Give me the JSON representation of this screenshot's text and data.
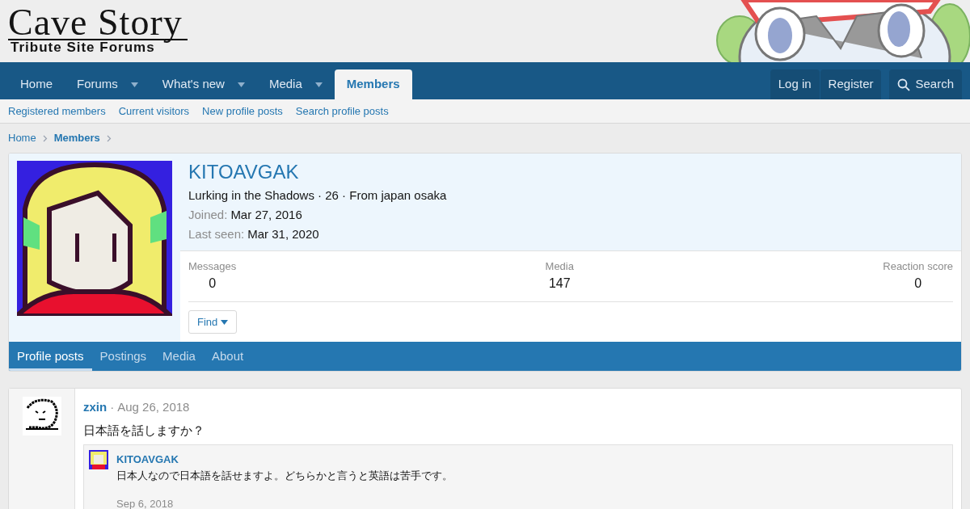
{
  "logo": {
    "title": "Cave Story",
    "subtitle": "Tribute Site Forums"
  },
  "nav": {
    "tabs": [
      {
        "label": "Home",
        "dropdown": false,
        "selected": false
      },
      {
        "label": "Forums",
        "dropdown": true,
        "selected": false
      },
      {
        "label": "What's new",
        "dropdown": true,
        "selected": false
      },
      {
        "label": "Media",
        "dropdown": true,
        "selected": false
      },
      {
        "label": "Members",
        "dropdown": false,
        "selected": true
      }
    ],
    "account": [
      "Log in",
      "Register"
    ],
    "search": "Search"
  },
  "subnav": [
    "Registered members",
    "Current visitors",
    "New profile posts",
    "Search profile posts"
  ],
  "breadcrumb": [
    "Home",
    "Members"
  ],
  "profile": {
    "username": "KITOAVGAK",
    "blurb": "Lurking in the Shadows · 26 · From japan osaka",
    "facts": [
      {
        "label": "Joined:",
        "value": "Mar 27, 2016"
      },
      {
        "label": "Last seen:",
        "value": "Mar 31, 2020"
      }
    ],
    "stats": [
      {
        "label": "Messages",
        "value": "0"
      },
      {
        "label": "Media",
        "value": "147"
      },
      {
        "label": "Reaction score",
        "value": "0"
      }
    ],
    "find": "Find",
    "tabs": [
      {
        "label": "Profile posts",
        "selected": true
      },
      {
        "label": "Postings",
        "selected": false
      },
      {
        "label": "Media",
        "selected": false
      },
      {
        "label": "About",
        "selected": false
      }
    ]
  },
  "post": {
    "author": "zxin",
    "separator": "·",
    "date": "Aug 26, 2018",
    "text": "日本語を話しますか？",
    "comment": {
      "author": "KITOAVGAK",
      "text": "日本人なので日本語を話せますよ。どちらかと言うと英語は苦手です。",
      "date": "Sep 6, 2018"
    }
  }
}
